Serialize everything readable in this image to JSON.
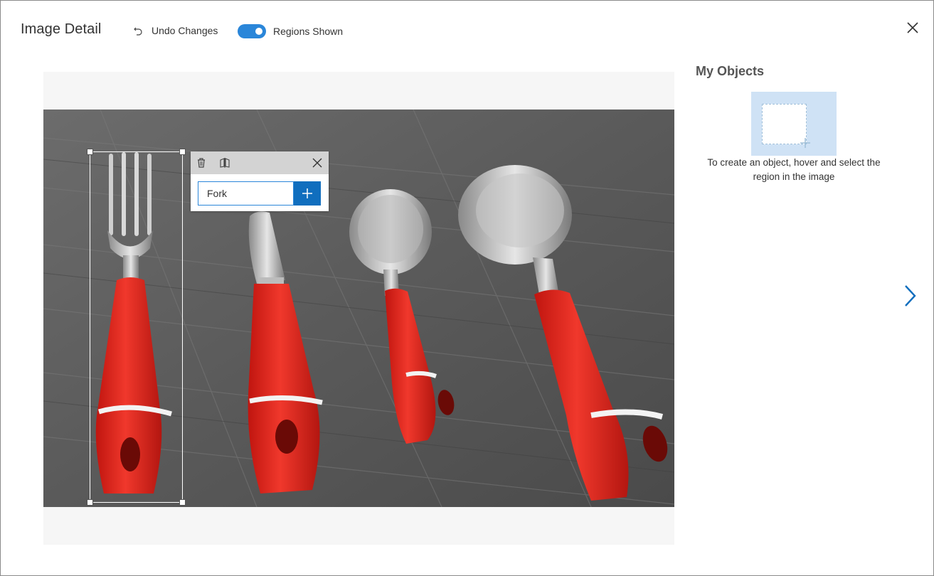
{
  "header": {
    "title": "Image Detail",
    "undo_label": "Undo Changes",
    "toggle_label": "Regions Shown",
    "regions_shown": true
  },
  "region_editor": {
    "tag_value": "Fork",
    "icons": [
      "trash-icon",
      "split-icon",
      "close-icon",
      "plus-icon"
    ]
  },
  "objects_panel": {
    "title": "My Objects",
    "help_text": "To create an object, hover and select the region in the image"
  },
  "icons": {
    "undo": "undo-icon",
    "close": "close-icon",
    "next": "chevron-right-icon"
  },
  "colors": {
    "accent": "#2a86d9",
    "add_button": "#106ebe",
    "utensil_handle": "#e02a20",
    "canvas_bg": "#f6f6f6",
    "object_thumb_bg": "#cfe2f5"
  }
}
